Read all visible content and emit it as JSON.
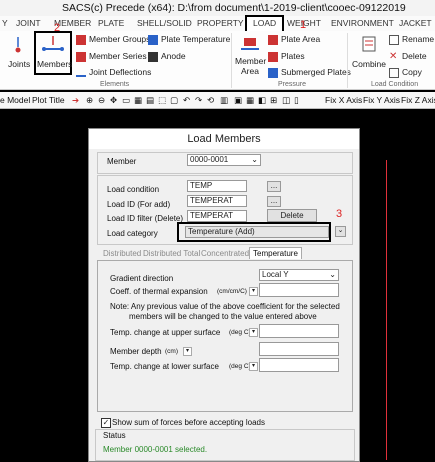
{
  "app": {
    "title": "SACS(c) Precede (x64):  D:\\from document\\1-2019-client\\cooec-09122019"
  },
  "tabs": [
    "Y",
    "JOINT",
    "MEMBER",
    "PLATE",
    "SHELL/SOLID",
    "PROPERTY",
    "LOAD",
    "WEIGHT",
    "ENVIRONMENT",
    "JACKET"
  ],
  "active_tab": "LOAD",
  "ribbon": {
    "joints": "Joints",
    "members": "Members",
    "member_groups": "Member Groups",
    "member_series": "Member Series",
    "joint_deflections": "Joint Deflections",
    "plate_temperature": "Plate Temperature",
    "anode": "Anode",
    "elements_group": "Elements",
    "member_area_line1": "Member",
    "member_area_line2": "Area",
    "plate_area": "Plate Area",
    "plates": "Plates",
    "submerged_plates": "Submerged Plates",
    "pressure_group": "Pressure",
    "combine": "Combine",
    "rename": "Rename",
    "delete": "Delete",
    "copy": "Copy",
    "load_condition_group": "Load Condition"
  },
  "annotations": {
    "a1": "1",
    "a2": "2",
    "a3": "3"
  },
  "toolbar": {
    "line_model": "e Model",
    "plot_title": "Plot Title",
    "fix_x": "Fix X Axis",
    "fix_y": "Fix Y Axis",
    "fix_z": "Fix Z Axis"
  },
  "dialog": {
    "title": "Load Members",
    "member_label": "Member",
    "member_value": "0000-0001",
    "load_condition_label": "Load condition",
    "load_condition_value": "TEMP",
    "load_id_add_label": "Load ID (For add)",
    "load_id_add_value": "TEMPERAT",
    "load_id_filter_label": "Load ID filter (Delete)",
    "load_id_filter_value": "TEMPERAT",
    "delete_button": "Delete",
    "ellipsis": "...",
    "load_category_label": "Load category",
    "load_category_value": "Temperature (Add)",
    "tabs": [
      "Distributed",
      "Distributed Total",
      "Concentrated",
      "Temperature"
    ],
    "active_tab": "Temperature",
    "gradient_direction_label": "Gradient direction",
    "gradient_direction_value": "Local Y",
    "coeff_label": "Coeff. of thermal expansion",
    "coeff_unit": "(cm/cm/C)",
    "note_line1": "Note: Any previous value of the above coefficient for the selected",
    "note_line2": "members will be changed to the value entered above",
    "temp_upper_label": "Temp. change at upper surface",
    "temp_upper_unit": "(deg C)",
    "member_depth_label": "Member depth",
    "member_depth_unit": "(cm)",
    "temp_lower_label": "Temp. change at lower surface",
    "temp_lower_unit": "(deg C)",
    "show_sum_label": "Show sum of forces before accepting loads",
    "status_label": "Status",
    "status_text": "Member 0000-0001 selected."
  }
}
